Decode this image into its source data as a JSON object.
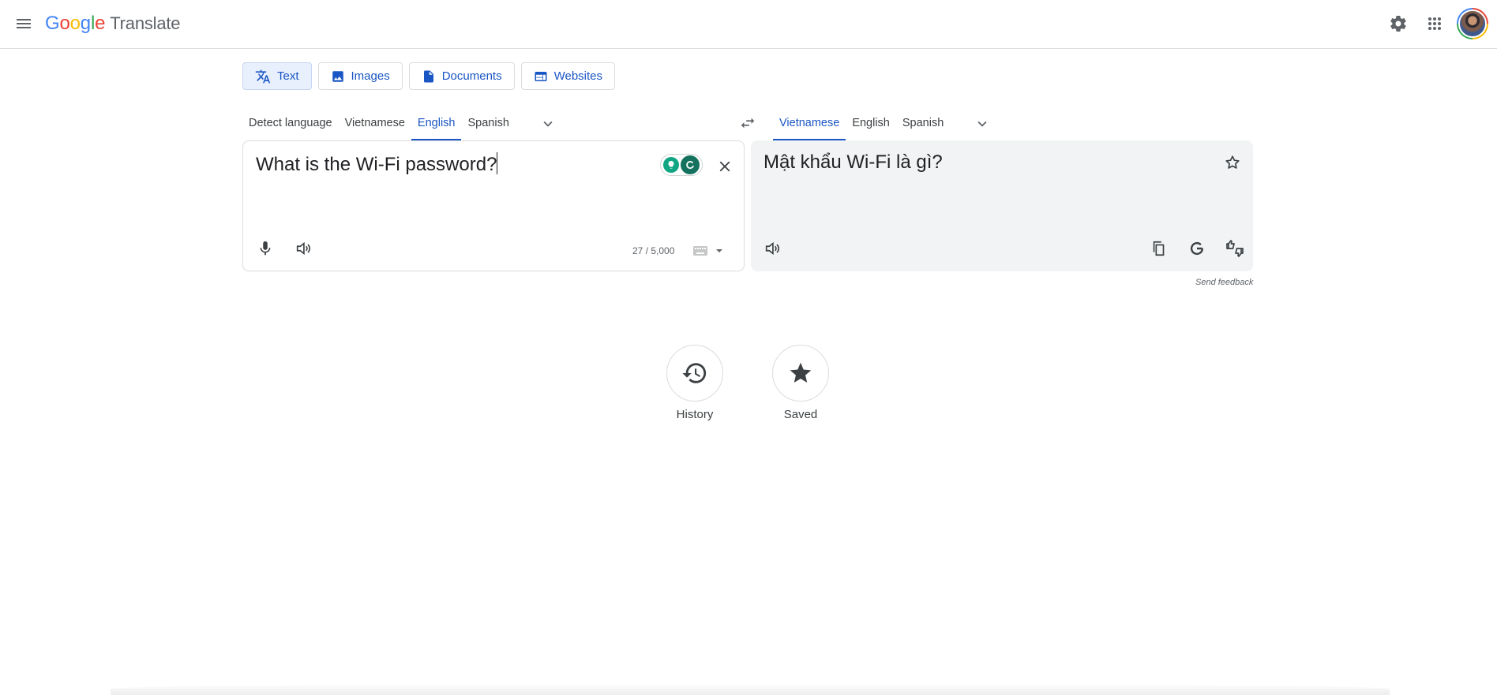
{
  "app": {
    "logo_word": [
      "G",
      "o",
      "o",
      "g",
      "l",
      "e"
    ],
    "logo_colors": [
      "#4285f4",
      "#ea4335",
      "#fbbc04",
      "#4285f4",
      "#34a853",
      "#ea4335"
    ],
    "product_name": "Translate"
  },
  "header": {
    "icons": [
      "menu-icon",
      "settings-icon",
      "apps-grid-icon",
      "avatar"
    ]
  },
  "mode_tabs": [
    {
      "label": "Text",
      "icon": "translate-icon",
      "active": true
    },
    {
      "label": "Images",
      "icon": "image-icon",
      "active": false
    },
    {
      "label": "Documents",
      "icon": "document-icon",
      "active": false
    },
    {
      "label": "Websites",
      "icon": "website-icon",
      "active": false
    }
  ],
  "source": {
    "languages": [
      {
        "label": "Detect language",
        "active": false
      },
      {
        "label": "Vietnamese",
        "active": false
      },
      {
        "label": "English",
        "active": true
      },
      {
        "label": "Spanish",
        "active": false
      }
    ],
    "text": "What is the Wi-Fi password?",
    "char_count": "27 / 5,000"
  },
  "target": {
    "languages": [
      {
        "label": "Vietnamese",
        "active": true
      },
      {
        "label": "English",
        "active": false
      },
      {
        "label": "Spanish",
        "active": false
      }
    ],
    "text": "Mật khẩu Wi-Fi là gì?"
  },
  "send_feedback": "Send feedback",
  "actions": {
    "history_label": "History",
    "saved_label": "Saved"
  },
  "colors": {
    "accent": "#1a56c4",
    "active_tab_bg": "#e8f0fe",
    "target_panel_bg": "#f1f3f4",
    "icon_gray": "#5f6368"
  }
}
